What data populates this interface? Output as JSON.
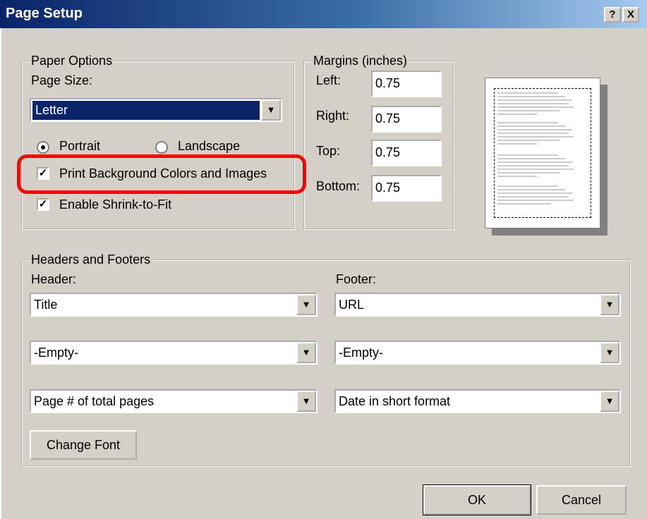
{
  "window": {
    "title": "Page Setup",
    "context_help_btn": "?",
    "close_btn": "X"
  },
  "paper_options": {
    "legend": "Paper Options",
    "page_size_label": "Page Size:",
    "page_size_value": "Letter",
    "portrait_label": "Portrait",
    "landscape_label": "Landscape",
    "orientation_selected": "Portrait",
    "print_bg_label": "Print Background Colors and Images",
    "print_bg_checked": true,
    "shrink_label": "Enable Shrink-to-Fit",
    "shrink_checked": true
  },
  "margins": {
    "legend": "Margins (inches)",
    "left_label": "Left:",
    "left_value": "0.75",
    "right_label": "Right:",
    "right_value": "0.75",
    "top_label": "Top:",
    "top_value": "0.75",
    "bottom_label": "Bottom:",
    "bottom_value": "0.75"
  },
  "headers_footers": {
    "legend": "Headers and Footers",
    "header_label": "Header:",
    "footer_label": "Footer:",
    "header_values": [
      "Title",
      "-Empty-",
      "Page # of total pages"
    ],
    "footer_values": [
      "URL",
      "-Empty-",
      "Date in short format"
    ],
    "change_font_label": "Change Font"
  },
  "buttons": {
    "ok": "OK",
    "cancel": "Cancel"
  },
  "colors": {
    "titlebar_start": "#0a246a",
    "titlebar_end": "#a6caf0",
    "face": "#d4d0c8",
    "highlight": "#ff0000"
  }
}
